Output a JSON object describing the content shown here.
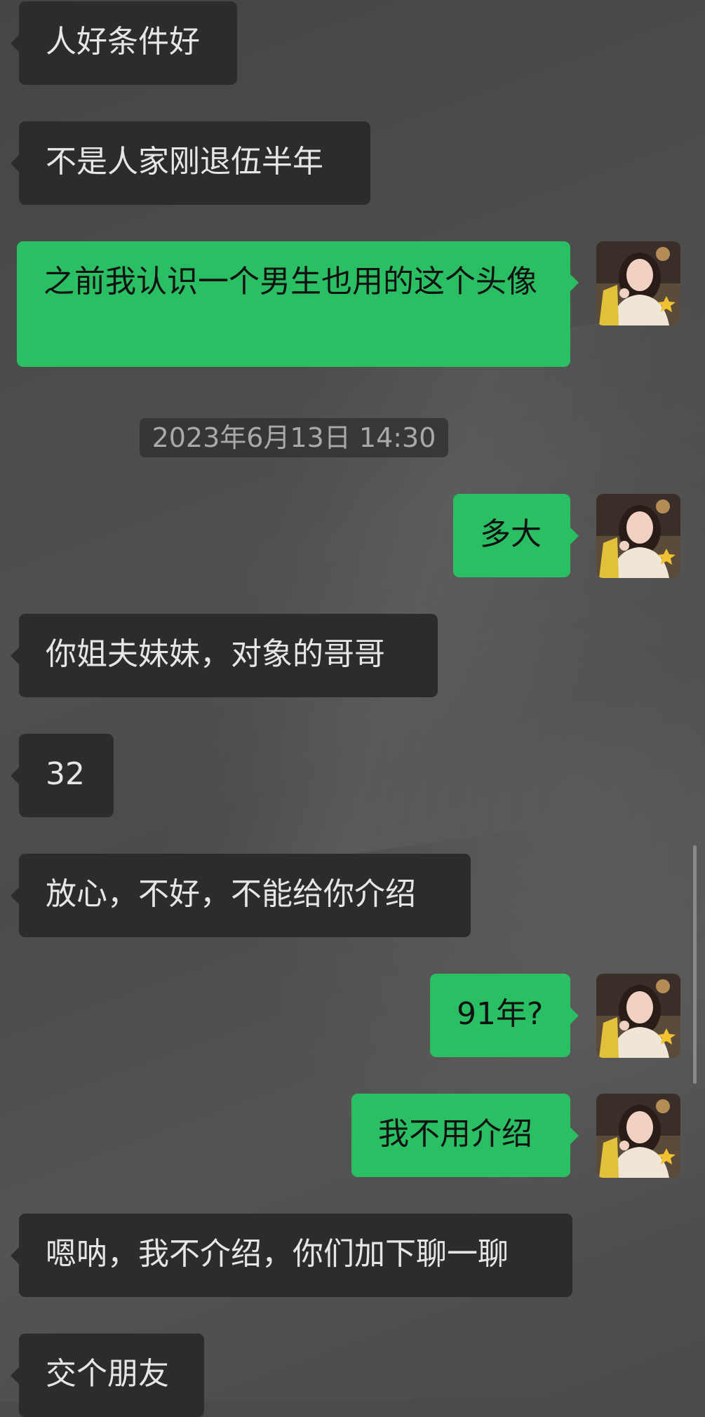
{
  "timestamp": "2023年6月13日 14:30",
  "messages": [
    {
      "side": "in",
      "text": "人好条件好"
    },
    {
      "side": "in",
      "text": "不是人家刚退伍半年"
    },
    {
      "side": "out",
      "text": "之前我认识一个男生也用的这个头像"
    },
    {
      "side": "out",
      "text": "多大"
    },
    {
      "side": "in",
      "text": "你姐夫妹妹，对象的哥哥"
    },
    {
      "side": "in",
      "text": "32"
    },
    {
      "side": "in",
      "text": "放心，不好，不能给你介绍"
    },
    {
      "side": "out",
      "text": "91年?"
    },
    {
      "side": "out",
      "text": "我不用介绍"
    },
    {
      "side": "in",
      "text": "嗯呐，我不介绍，你们加下聊一聊"
    },
    {
      "side": "in",
      "text": "交个朋友"
    }
  ],
  "avatar_icon": "user-avatar-photo",
  "colors": {
    "incoming_bubble": "#2c2c2c",
    "outgoing_bubble": "#2bbf64",
    "background": "#4a4a4a"
  }
}
